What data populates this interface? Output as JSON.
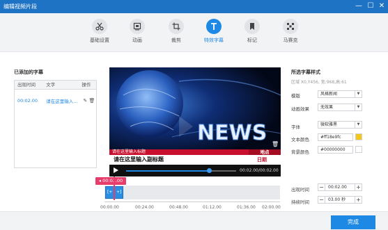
{
  "window": {
    "title": "编辑视频片段",
    "minimize": "—",
    "maximize": "☐",
    "close": "✕"
  },
  "toolbar": {
    "tools": [
      {
        "label": "基础设置",
        "icon": "scissors-icon"
      },
      {
        "label": "动画",
        "icon": "animation-icon"
      },
      {
        "label": "裁剪",
        "icon": "crop-icon"
      },
      {
        "label": "特效字幕",
        "icon": "text-effect-icon",
        "active": true
      },
      {
        "label": "标记",
        "icon": "bookmark-icon"
      },
      {
        "label": "马赛克",
        "icon": "mosaic-icon"
      }
    ]
  },
  "subtitles_panel": {
    "title": "已添加的字幕",
    "columns": [
      "出现时间",
      "文字",
      "操作"
    ],
    "rows": [
      {
        "time": "00:02.00",
        "text": "请在这里输入..."
      }
    ]
  },
  "preview": {
    "news_word": "NEWS",
    "lower_third_top": "请在这里输入标题",
    "lower_third_tag": "地点",
    "lower_third_title": "请在这里输入副标题",
    "lower_third_date": "日期",
    "time_readout": "00:02.00/00:02.00",
    "progress": 0.75
  },
  "timeline": {
    "flag_time": "00:02.00",
    "clip_left": "[+",
    "clip_right": "+]",
    "ticks": [
      "00:00.00",
      "00:24.00",
      "00:48.00",
      "01:12.00",
      "01:36.00",
      "02:00.00"
    ]
  },
  "style_panel": {
    "title": "所选字幕样式",
    "subtitle": "区域 X0,Y456, 宽:968,高:61",
    "template_label": "模版",
    "template_value": "风格新闻",
    "effect_label": "动画效果",
    "effect_value": "无效果",
    "font_label": "字体",
    "font_value": "微软雅黑",
    "text_color_label": "文本颜色",
    "text_color_value": "#ff18e9fc",
    "text_color_swatch": "#f5c518",
    "bg_color_label": "背景颜色",
    "bg_color_value": "#00000000",
    "bg_color_swatch": "#ffffff",
    "appear_label": "出现时间",
    "appear_value": "00:02.00",
    "duration_label": "持续时间",
    "duration_value": "03.00 秒"
  },
  "footer": {
    "done_label": "完成"
  },
  "colors": {
    "accent": "#1e88e5",
    "titlebar": "#1f73c4",
    "marker": "#e83c6b",
    "news_red": "#c8102e"
  }
}
